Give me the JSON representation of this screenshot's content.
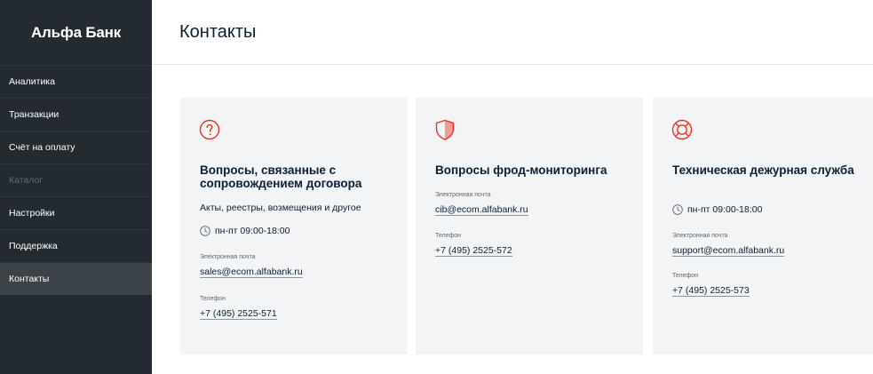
{
  "sidebar": {
    "logo": "Альфа Банк",
    "items": [
      {
        "label": "Аналитика",
        "state": "normal"
      },
      {
        "label": "Транзакции",
        "state": "normal"
      },
      {
        "label": "Счёт на оплату",
        "state": "normal"
      },
      {
        "label": "Каталог",
        "state": "disabled"
      },
      {
        "label": "Настройки",
        "state": "normal"
      },
      {
        "label": "Поддержка",
        "state": "normal"
      },
      {
        "label": "Контакты",
        "state": "active"
      }
    ]
  },
  "header": {
    "title": "Контакты"
  },
  "cards": [
    {
      "icon": "question-circle-icon",
      "title": "Вопросы, связанные с сопровождением договора",
      "description": "Акты, реестры, возмещения и другое",
      "hours": "пн-пт 09:00-18:00",
      "email_label": "Электронная почта",
      "email": "sales@ecom.alfabank.ru",
      "phone_label": "Телефон",
      "phone": "+7 (495) 2525-571"
    },
    {
      "icon": "shield-icon",
      "title": "Вопросы фрод-мониторинга",
      "email_label": "Электронная почта",
      "email": "cib@ecom.alfabank.ru",
      "phone_label": "Телефон",
      "phone": "+7 (495) 2525-572"
    },
    {
      "icon": "lifebuoy-icon",
      "title": "Техническая дежурная служба",
      "hours": "пн-пт 09:00-18:00",
      "email_label": "Электронная почта",
      "email": "support@ecom.alfabank.ru",
      "phone_label": "Телефон",
      "phone": "+7 (495) 2525-573"
    }
  ],
  "colors": {
    "accent": "#ef3124",
    "sidebar_bg": "#232b31",
    "sidebar_active": "#3b4349",
    "card_bg": "#f3f4f5",
    "text": "#0b1f35"
  }
}
